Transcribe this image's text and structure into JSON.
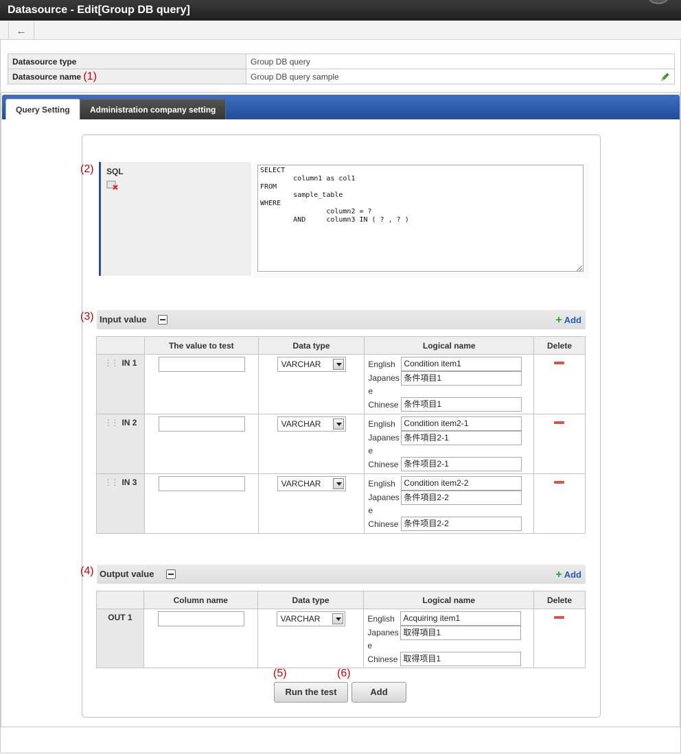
{
  "window": {
    "title": "Datasource - Edit[Group DB query]"
  },
  "toolbar": {
    "back_icon": "←"
  },
  "info": {
    "type_label": "Datasource type",
    "type_value": "Group DB query",
    "name_label": "Datasource name",
    "name_marker": "(1)",
    "name_value": "Group DB query sample"
  },
  "tabs": [
    {
      "label": "Query Setting",
      "active": true
    },
    {
      "label": "Administration company setting",
      "active": false
    }
  ],
  "sql": {
    "marker": "(2)",
    "label": "SQL",
    "text": "SELECT\n        column1 as col1\nFROM\n        sample_table\nWHERE\n                column2 = ?\n        AND     column3 IN ( ? , ? )"
  },
  "input_section": {
    "marker": "(3)",
    "title": "Input value",
    "add_label": "Add",
    "headers": [
      "The value to test",
      "Data type",
      "Logical name",
      "Delete"
    ],
    "rows": [
      {
        "name": "IN 1",
        "value": "",
        "type": "VARCHAR",
        "english": "Condition item1",
        "japanese": "条件項目1",
        "chinese": "条件项目1"
      },
      {
        "name": "IN 2",
        "value": "",
        "type": "VARCHAR",
        "english": "Condition item2-1",
        "japanese": "条件項目2-1",
        "chinese": "条件项目2-1"
      },
      {
        "name": "IN 3",
        "value": "",
        "type": "VARCHAR",
        "english": "Condition item2-2",
        "japanese": "条件項目2-2",
        "chinese": "条件项目2-2"
      }
    ]
  },
  "output_section": {
    "marker": "(4)",
    "title": "Output value",
    "add_label": "Add",
    "headers": [
      "Column name",
      "Data type",
      "Logical name",
      "Delete"
    ],
    "rows": [
      {
        "name": "OUT 1",
        "value": "",
        "type": "VARCHAR",
        "english": "Acquiring item1",
        "japanese": "取得項目1",
        "chinese": "取得项目1"
      }
    ]
  },
  "lang_labels": {
    "english": "English",
    "japanese_1": "Japanes",
    "japanese_2": "e",
    "chinese": "Chinese"
  },
  "buttons": {
    "run_marker": "(5)",
    "run_label": "Run the test",
    "add_marker": "(6)",
    "add_label": "Add"
  },
  "colors": {
    "tabbar": "#2a5aab",
    "marker": "#cc0000",
    "add_link": "#1f5db3",
    "delete": "#d9534f"
  }
}
